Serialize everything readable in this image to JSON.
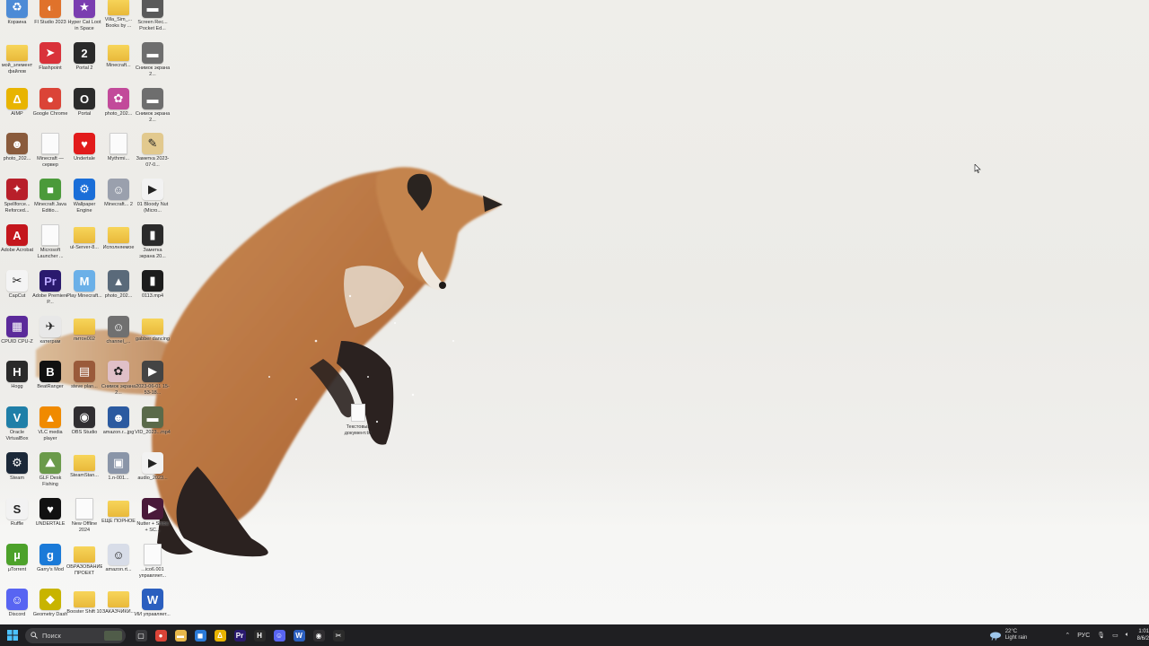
{
  "desktop": {
    "icons": [
      {
        "label": "Корзина",
        "color": "#4d8bd6",
        "symbol": "♻",
        "icon": "recycle-bin-icon",
        "type": "app"
      },
      {
        "label": "Fl Studio 2023",
        "color": "#e0722b",
        "symbol": "◐",
        "icon": "fl-studio-icon",
        "type": "app"
      },
      {
        "label": "Hyper Cat Loot in Space",
        "color": "#7a3db0",
        "symbol": "★",
        "icon": "game-icon",
        "type": "app"
      },
      {
        "label": "Villa_Sim_... Books by ...",
        "color": "",
        "symbol": "",
        "icon": "folder-icon",
        "type": "folder"
      },
      {
        "label": "Screen Rec... Pocket Ed...",
        "color": "#5a5a5a",
        "symbol": "▬",
        "icon": "screenshot-icon",
        "type": "app"
      },
      {
        "label": "мой_элемент файлов",
        "color": "",
        "symbol": "",
        "icon": "folder-icon",
        "type": "folder"
      },
      {
        "label": "Flashpoint",
        "color": "#d9323a",
        "symbol": "➤",
        "icon": "flashpoint-icon",
        "type": "app"
      },
      {
        "label": "Portal 2",
        "color": "#2a2a2a",
        "symbol": "2",
        "icon": "portal-2-icon",
        "type": "app"
      },
      {
        "label": "Minecraft...",
        "color": "",
        "symbol": "",
        "icon": "folder-icon",
        "type": "folder"
      },
      {
        "label": "Снимок экрана 2...",
        "color": "#6e6e6e",
        "symbol": "▬",
        "icon": "screenshot-icon",
        "type": "app"
      },
      {
        "label": "AIMP",
        "color": "#e8b400",
        "symbol": "Δ",
        "icon": "aimp-icon",
        "type": "app"
      },
      {
        "label": "Google Chrome",
        "color": "#db4437",
        "symbol": "●",
        "icon": "chrome-icon",
        "type": "app"
      },
      {
        "label": "Portal",
        "color": "#2b2b2b",
        "symbol": "O",
        "icon": "portal-icon",
        "type": "app"
      },
      {
        "label": "photo_202...",
        "color": "#c24a9a",
        "symbol": "✿",
        "icon": "photo-icon",
        "type": "app"
      },
      {
        "label": "Снимок экрана 2...",
        "color": "#6e6e6e",
        "symbol": "▬",
        "icon": "screenshot-icon",
        "type": "app"
      },
      {
        "label": "photo_202...",
        "color": "#8a5b3c",
        "symbol": "☻",
        "icon": "photo-icon",
        "type": "app"
      },
      {
        "label": "Minecraft — сервер",
        "color": "",
        "symbol": "",
        "icon": "file-icon",
        "type": "file"
      },
      {
        "label": "Undertale",
        "color": "#e21b1b",
        "symbol": "♥",
        "icon": "undertale-heart-icon",
        "type": "app"
      },
      {
        "label": "Mythrmi...",
        "color": "",
        "symbol": "",
        "icon": "file-icon",
        "type": "file"
      },
      {
        "label": "Заметка 2023-07-0...",
        "color": "#e2c98e",
        "symbol": "✎",
        "icon": "note-icon",
        "type": "app"
      },
      {
        "label": "Spellforce... Reforced...",
        "color": "#b81f2a",
        "symbol": "✦",
        "icon": "game-icon",
        "type": "app"
      },
      {
        "label": "Minecraft Java Editio...",
        "color": "#4b9a3a",
        "symbol": "■",
        "icon": "minecraft-icon",
        "type": "app"
      },
      {
        "label": "Wallpaper Engine",
        "color": "#1a6ed8",
        "symbol": "⚙",
        "icon": "wallpaper-engine-icon",
        "type": "app"
      },
      {
        "label": "Minecraft... 2",
        "color": "#9aa0ad",
        "symbol": "☺",
        "icon": "photo-icon",
        "type": "app"
      },
      {
        "label": "01 Bloody Nut (Micro...",
        "color": "#f2f2f2",
        "symbol": "▶",
        "icon": "video-icon",
        "type": "app"
      },
      {
        "label": "Adobe Acrobat",
        "color": "#c4161c",
        "symbol": "A",
        "icon": "acrobat-icon",
        "type": "app"
      },
      {
        "label": "Microsoft Launcher ...",
        "color": "",
        "symbol": "",
        "icon": "file-icon",
        "type": "file"
      },
      {
        "label": "ul-Server-8...",
        "color": "",
        "symbol": "",
        "icon": "folder-icon",
        "type": "folder"
      },
      {
        "label": "Исполняемое",
        "color": "",
        "symbol": "",
        "icon": "folder-icon",
        "type": "folder"
      },
      {
        "label": "Заметка экрана 20...",
        "color": "#2b2b2b",
        "symbol": "▮",
        "icon": "screenshot-icon",
        "type": "app"
      },
      {
        "label": "CapCut",
        "color": "#f4f4f4",
        "symbol": "✂",
        "icon": "capcut-icon",
        "type": "app"
      },
      {
        "label": "Adobe Premiere P...",
        "color": "#2a1a6e",
        "symbol": "Pr",
        "icon": "premiere-icon",
        "type": "app"
      },
      {
        "label": "Play Minecraft...",
        "color": "#6bb0e8",
        "symbol": "M",
        "icon": "minecraft-icon",
        "type": "app"
      },
      {
        "label": "photo_202...",
        "color": "#5a6a7a",
        "symbol": "▲",
        "icon": "photo-icon",
        "type": "app"
      },
      {
        "label": "0113.mp4",
        "color": "#1c1c1c",
        "symbol": "▮",
        "icon": "video-icon",
        "type": "app"
      },
      {
        "label": "CPUID CPU-Z",
        "color": "#5b2a9a",
        "symbol": "▦",
        "icon": "cpu-z-icon",
        "type": "app"
      },
      {
        "label": "категрам",
        "color": "#e8e8e8",
        "symbol": "✈",
        "icon": "telegram-icon",
        "type": "app"
      },
      {
        "label": "питон002",
        "color": "",
        "symbol": "",
        "icon": "folder-icon",
        "type": "folder"
      },
      {
        "label": "channel_...",
        "color": "#707070",
        "symbol": "☺",
        "icon": "photo-icon",
        "type": "app"
      },
      {
        "label": "gabber dancing",
        "color": "",
        "symbol": "",
        "icon": "folder-icon",
        "type": "folder"
      },
      {
        "label": "Hogg",
        "color": "#2a2a2a",
        "symbol": "H",
        "icon": "hogg-icon",
        "type": "app"
      },
      {
        "label": "BeatRanger",
        "color": "#111111",
        "symbol": "B",
        "icon": "app-icon",
        "type": "app"
      },
      {
        "label": "steve plan...",
        "color": "#9a5a3a",
        "symbol": "▤",
        "icon": "photo-icon",
        "type": "app"
      },
      {
        "label": "Снимок экрана 2...",
        "color": "#e0c0c8",
        "symbol": "✿",
        "icon": "photo-icon",
        "type": "app"
      },
      {
        "label": "2023-06-01 15-53-18...",
        "color": "#444444",
        "symbol": "▶",
        "icon": "video-icon",
        "type": "app"
      },
      {
        "label": "Oracle VirtualBox",
        "color": "#1f7fa8",
        "symbol": "V",
        "icon": "virtualbox-icon",
        "type": "app"
      },
      {
        "label": "VLC media player",
        "color": "#f08a00",
        "symbol": "▲",
        "icon": "vlc-icon",
        "type": "app"
      },
      {
        "label": "OBS Studio",
        "color": "#302e31",
        "symbol": "◉",
        "icon": "obs-icon",
        "type": "app"
      },
      {
        "label": "amazon.r...jpg",
        "color": "#2b5aa0",
        "symbol": "☻",
        "icon": "photo-icon",
        "type": "app"
      },
      {
        "label": "VID_2023...mp4",
        "color": "#5a6a4a",
        "symbol": "▬",
        "icon": "video-icon",
        "type": "app"
      },
      {
        "label": "Steam",
        "color": "#1b2838",
        "symbol": "⚙",
        "icon": "steam-icon",
        "type": "app"
      },
      {
        "label": "GLF Desk Fishing",
        "color": "#6a9a4a",
        "symbol": "⛰",
        "icon": "game-icon",
        "type": "app"
      },
      {
        "label": "SteamStan...",
        "color": "",
        "symbol": "",
        "icon": "folder-icon",
        "type": "folder"
      },
      {
        "label": "1.n-001...",
        "color": "#8a95a8",
        "symbol": "▣",
        "icon": "app-icon",
        "type": "app"
      },
      {
        "label": "audio_2023...",
        "color": "#f2f2f2",
        "symbol": "▶",
        "icon": "audio-icon",
        "type": "app"
      },
      {
        "label": "Ruffle",
        "color": "#f2f2f2",
        "symbol": "S",
        "icon": "ruffle-icon",
        "type": "app"
      },
      {
        "label": "UNDERTALE",
        "color": "#111111",
        "symbol": "♥",
        "icon": "undertale-icon",
        "type": "app"
      },
      {
        "label": "New Offline 2024",
        "color": "",
        "symbol": "",
        "icon": "file-icon",
        "type": "file"
      },
      {
        "label": "ЕЩЁ ПОРНОЕ",
        "color": "",
        "symbol": "",
        "icon": "folder-icon",
        "type": "folder"
      },
      {
        "label": "Nutter + Shiba + SC...",
        "color": "#4a1a3a",
        "symbol": "▶",
        "icon": "video-icon",
        "type": "app"
      },
      {
        "label": "µTorrent",
        "color": "#4ca12a",
        "symbol": "µ",
        "icon": "utorrent-icon",
        "type": "app"
      },
      {
        "label": "Garry's Mod",
        "color": "#1a7ad8",
        "symbol": "g",
        "icon": "garrys-mod-icon",
        "type": "app"
      },
      {
        "label": "ОБРАЗОВАНИЕ ПРОЕКТ",
        "color": "",
        "symbol": "",
        "icon": "folder-icon",
        "type": "folder"
      },
      {
        "label": "amazon.rt...",
        "color": "#d8dde8",
        "symbol": "☺",
        "icon": "photo-icon",
        "type": "app"
      },
      {
        "label": "...ico6.001 управляет...",
        "color": "",
        "symbol": "",
        "icon": "file-icon",
        "type": "file"
      },
      {
        "label": "Discord",
        "color": "#5865f2",
        "symbol": "☺",
        "icon": "discord-icon",
        "type": "app"
      },
      {
        "label": "Geometry Dash",
        "color": "#c8b400",
        "symbol": "◆",
        "icon": "geometry-dash-icon",
        "type": "app"
      },
      {
        "label": "Booster Shift 10",
        "color": "",
        "symbol": "",
        "icon": "folder-icon",
        "type": "folder"
      },
      {
        "label": "ЗАКАЗЧИКИ...",
        "color": "",
        "symbol": "",
        "icon": "folder-icon",
        "type": "folder"
      },
      {
        "label": "ИИ управляет...",
        "color": "#2b5fbf",
        "symbol": "W",
        "icon": "word-document-icon",
        "type": "app"
      }
    ],
    "center_file": {
      "label": "Текстовый документ.txt"
    }
  },
  "taskbar": {
    "search_placeholder": "Поиск",
    "apps": [
      {
        "icon": "task-view-icon",
        "symbol": "▢",
        "color": "#3a3a3d"
      },
      {
        "icon": "chrome-icon",
        "symbol": "●",
        "color": "#db4437"
      },
      {
        "icon": "file-explorer-icon",
        "symbol": "▬",
        "color": "#e8b84a"
      },
      {
        "icon": "store-icon",
        "symbol": "◼",
        "color": "#2b7bd8"
      },
      {
        "icon": "aimp-icon",
        "symbol": "Δ",
        "color": "#e8b400"
      },
      {
        "icon": "premiere-icon",
        "symbol": "Pr",
        "color": "#2a1a6e"
      },
      {
        "icon": "hogg-icon",
        "symbol": "H",
        "color": "#2a2a2a"
      },
      {
        "icon": "discord-icon",
        "symbol": "☺",
        "color": "#5865f2"
      },
      {
        "icon": "word-icon",
        "symbol": "W",
        "color": "#2b5fbf"
      },
      {
        "icon": "obs-icon",
        "symbol": "◉",
        "color": "#302e31"
      },
      {
        "icon": "capcut-icon",
        "symbol": "✂",
        "color": "#2b2b2b"
      }
    ],
    "weather": {
      "temp": "22°C",
      "condition": "Light rain"
    },
    "lang": "РУС",
    "clock": {
      "time": "1:01",
      "date": "8/6/2"
    }
  }
}
